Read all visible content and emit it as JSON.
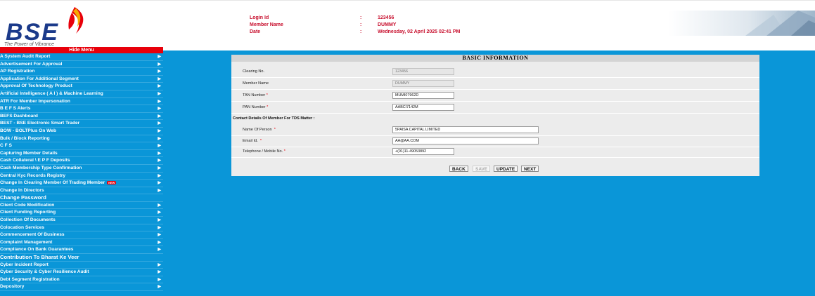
{
  "header": {
    "logo_text": "BSE",
    "tagline": "The Power of Vibrance",
    "info": [
      {
        "label": "Login Id",
        "value": "123456"
      },
      {
        "label": "Member Name",
        "value": "DUMMY"
      },
      {
        "label": "Date",
        "value": "Wednesday, 02 April 2025 02:41 PM"
      }
    ],
    "separator": ":"
  },
  "sidebar": {
    "hide_menu_label": "Hide Menu",
    "items": [
      {
        "label": "A System Audit Report",
        "arrow": true
      },
      {
        "label": "Advertisement For Approval",
        "arrow": true
      },
      {
        "label": "AP Registration",
        "arrow": true
      },
      {
        "label": "Application For Additional Segment",
        "arrow": true
      },
      {
        "label": "Approval Of Technology Product",
        "arrow": true
      },
      {
        "label": "Artificial Intelligence ( A I ) & Machine Learning",
        "arrow": true
      },
      {
        "label": "ATR For Member Impersonation",
        "arrow": true
      },
      {
        "label": "B E F S Alerts",
        "arrow": true
      },
      {
        "label": "BEFS Dashboard",
        "arrow": true
      },
      {
        "label": "BEST - BSE Electronic Smart Trader",
        "arrow": true
      },
      {
        "label": "BOW - BOLTPlus On Web",
        "arrow": true
      },
      {
        "label": "Bulk / Block Reporting",
        "arrow": true
      },
      {
        "label": "C F S",
        "arrow": true
      },
      {
        "label": "Capturing Member Details",
        "arrow": true
      },
      {
        "label": "Cash Collateral \\ E P F Deposits",
        "arrow": true
      },
      {
        "label": "Cash Membership Type Confirmation",
        "arrow": true
      },
      {
        "label": "Central Kyc Records Registry",
        "arrow": true
      },
      {
        "label": "Change In Clearing Member Of Trading Member",
        "arrow": true,
        "badge": "NEW"
      },
      {
        "label": "Change In Directors",
        "arrow": true
      },
      {
        "label": "Change Password",
        "arrow": false,
        "big": true
      },
      {
        "label": "Client Code Modification",
        "arrow": true
      },
      {
        "label": "Client Funding Reporting",
        "arrow": true
      },
      {
        "label": "Collection Of Documents",
        "arrow": true
      },
      {
        "label": "Colocation Services",
        "arrow": true
      },
      {
        "label": "Commencement Of Business",
        "arrow": true
      },
      {
        "label": "Complaint Management",
        "arrow": true
      },
      {
        "label": "Compliance On Bank Guarantees",
        "arrow": true
      },
      {
        "label": "Contribution To Bharat Ke Veer",
        "arrow": false,
        "big": true
      },
      {
        "label": "Cyber Incident Report",
        "arrow": true
      },
      {
        "label": "Cyber Security & Cyber Resilience Audit",
        "arrow": true
      },
      {
        "label": "Debt Segment Registration",
        "arrow": true
      },
      {
        "label": "Depository",
        "arrow": true
      }
    ]
  },
  "form": {
    "title": "BASIC INFORMATION",
    "clearing_no": {
      "label": "Clearing No.",
      "value": "123456"
    },
    "member_name": {
      "label": "Member Name",
      "value": "DUMMY"
    },
    "tan_number": {
      "label": "TAN Number",
      "value": "MUMI07962D"
    },
    "pan_number": {
      "label": "PAN Number",
      "value": "AABCI7142M"
    },
    "contact_section": "Contact Details Of Member For TDS Matter :",
    "person_name": {
      "label": "Name Of Person",
      "value": "5PAISA CAPITAL LIMITED"
    },
    "email": {
      "label": "Email Id.",
      "value": "AA@AA.COM"
    },
    "phone": {
      "label": "Telephone / Mobile No.",
      "value": "+(91)11-49053892"
    },
    "required_mark": "*",
    "buttons": {
      "back": "BACK",
      "save": "SAVE",
      "update": "UPDATE",
      "next": "NEXT"
    }
  }
}
